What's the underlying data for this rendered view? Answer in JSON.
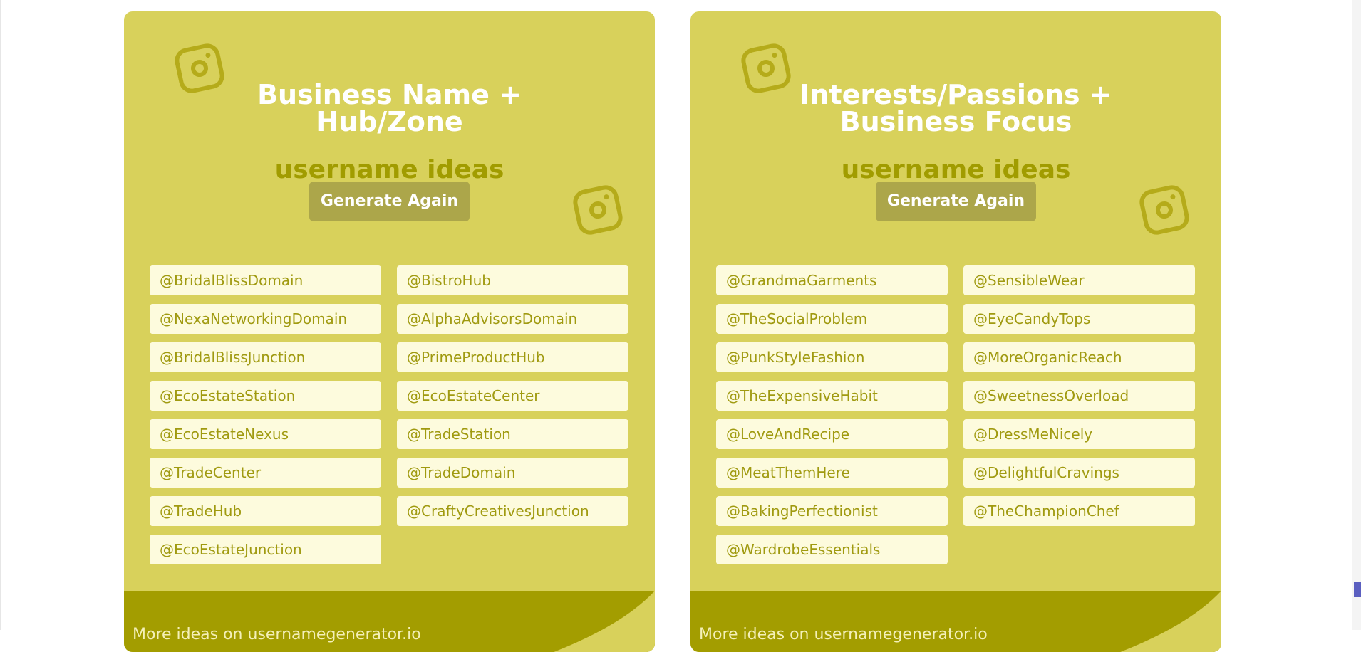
{
  "cards": [
    {
      "title_line1": "Business Name +",
      "title_line2": "Hub/Zone",
      "subtitle": "username ideas",
      "button_label": "Generate Again",
      "left_column": [
        "@BridalBlissDomain",
        "@NexaNetworkingDomain",
        "@BridalBlissJunction",
        "@EcoEstateStation",
        "@EcoEstateNexus",
        "@TradeCenter",
        "@TradeHub",
        "@EcoEstateJunction"
      ],
      "right_column": [
        "@BistroHub",
        "@AlphaAdvisorsDomain",
        "@PrimeProductHub",
        "@EcoEstateCenter",
        "@TradeStation",
        "@TradeDomain",
        "@CraftyCreativesJunction"
      ],
      "footer_text": "More ideas on usernamegenerator.io"
    },
    {
      "title_line1": "Interests/Passions +",
      "title_line2": "Business Focus",
      "subtitle": "username ideas",
      "button_label": "Generate Again",
      "left_column": [
        "@GrandmaGarments",
        "@TheSocialProblem",
        "@PunkStyleFashion",
        "@TheExpensiveHabit",
        "@LoveAndRecipe",
        "@MeatThemHere",
        "@BakingPerfectionist",
        "@WardrobeEssentials"
      ],
      "right_column": [
        "@SensibleWear",
        "@EyeCandyTops",
        "@MoreOrganicReach",
        "@SweetnessOverload",
        "@DressMeNicely",
        "@DelightfulCravings",
        "@TheChampionChef"
      ],
      "footer_text": "More ideas on usernamegenerator.io"
    }
  ],
  "icons": {
    "decoration": "instagram-icon"
  },
  "colors": {
    "card_bg": "#d8d15b",
    "accent_dark": "#a39d00",
    "button_bg": "#aca64a",
    "chip_bg": "#fdfbdd",
    "chip_text": "#a09a10"
  }
}
